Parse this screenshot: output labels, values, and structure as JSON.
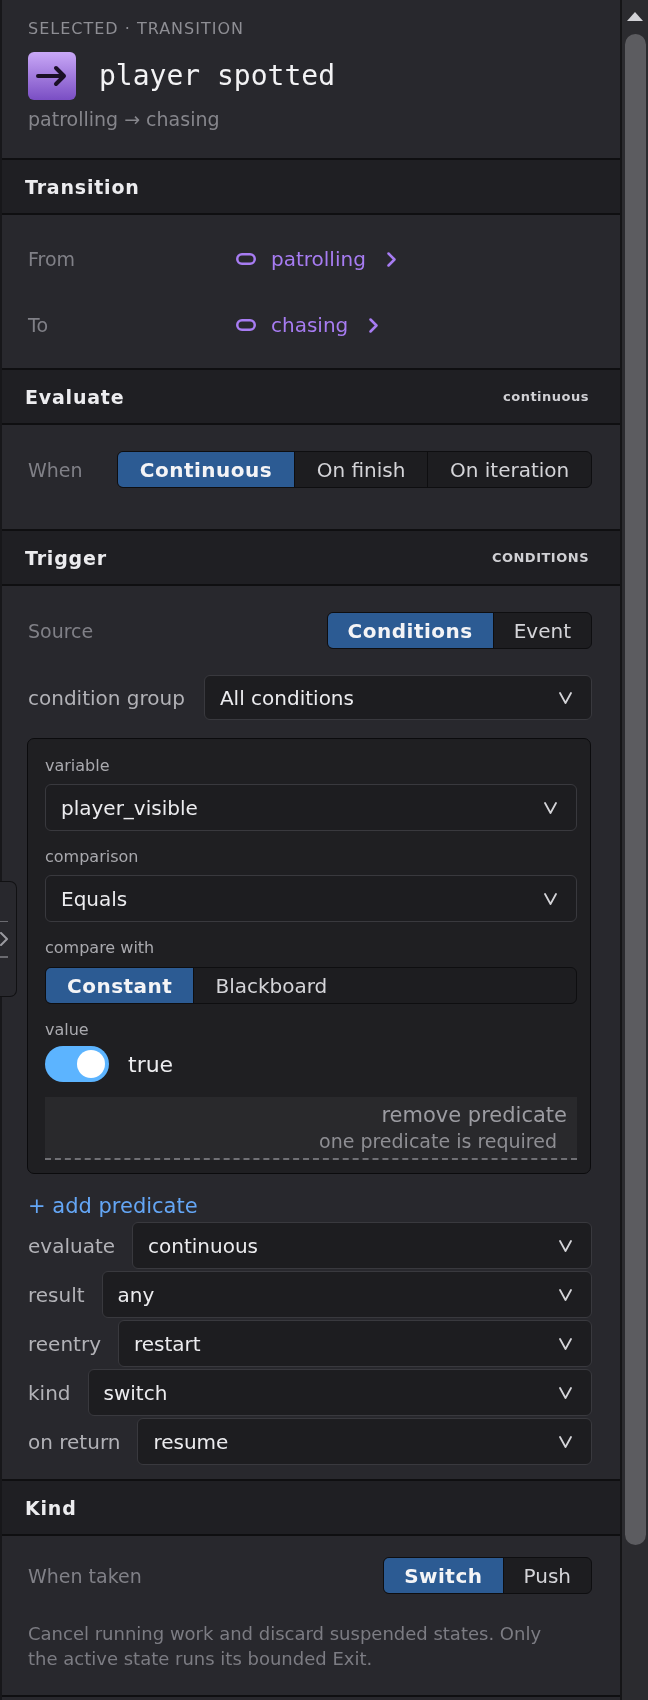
{
  "header": {
    "eyebrow": "SELECTED · TRANSITION",
    "title": "player spotted",
    "subtitle": "patrolling → chasing"
  },
  "sections": [
    {
      "kind": "transition",
      "title": "Transition",
      "links": [
        {
          "label": "From",
          "value": "patrolling"
        },
        {
          "label": "To",
          "value": "chasing"
        }
      ]
    },
    {
      "kind": "evaluate",
      "title": "Evaluate",
      "summary": "continuous",
      "label": "When",
      "options": [
        {
          "label": "Continuous",
          "selected": true
        },
        {
          "label": "On finish",
          "selected": false
        },
        {
          "label": "On iteration",
          "selected": false
        }
      ]
    },
    {
      "kind": "trigger",
      "title": "Trigger",
      "summary": "CONDITIONS",
      "source": {
        "label": "Source",
        "options": [
          {
            "label": "Conditions",
            "selected": true
          },
          {
            "label": "Event",
            "selected": false
          }
        ]
      },
      "condition_group": {
        "label": "condition group",
        "value": "All conditions"
      },
      "predicate": {
        "variable": {
          "label": "variable",
          "value": "player_visible"
        },
        "comparison": {
          "label": "comparison",
          "value": "Equals"
        },
        "compare_with": {
          "label": "compare with",
          "options": [
            {
              "label": "Constant",
              "selected": true
            },
            {
              "label": "Blackboard",
              "selected": false
            }
          ]
        },
        "value": {
          "label": "value",
          "on": true,
          "text": "true"
        },
        "remove": {
          "label": "remove predicate",
          "disabled": true,
          "note": "one predicate is required"
        }
      },
      "add_predicate": "+ add predicate",
      "settings": [
        {
          "label": "evaluate",
          "value": "continuous"
        },
        {
          "label": "result",
          "value": "any"
        },
        {
          "label": "reentry",
          "value": "restart"
        },
        {
          "label": "kind",
          "value": "switch"
        },
        {
          "label": "on return",
          "value": "resume"
        }
      ]
    },
    {
      "kind": "kind",
      "title": "Kind",
      "label": "When taken",
      "options": [
        {
          "label": "Switch",
          "selected": true
        },
        {
          "label": "Push",
          "selected": false
        }
      ],
      "description": "Cancel running work and discard suspended states. Only the active state runs its bounded Exit."
    }
  ]
}
